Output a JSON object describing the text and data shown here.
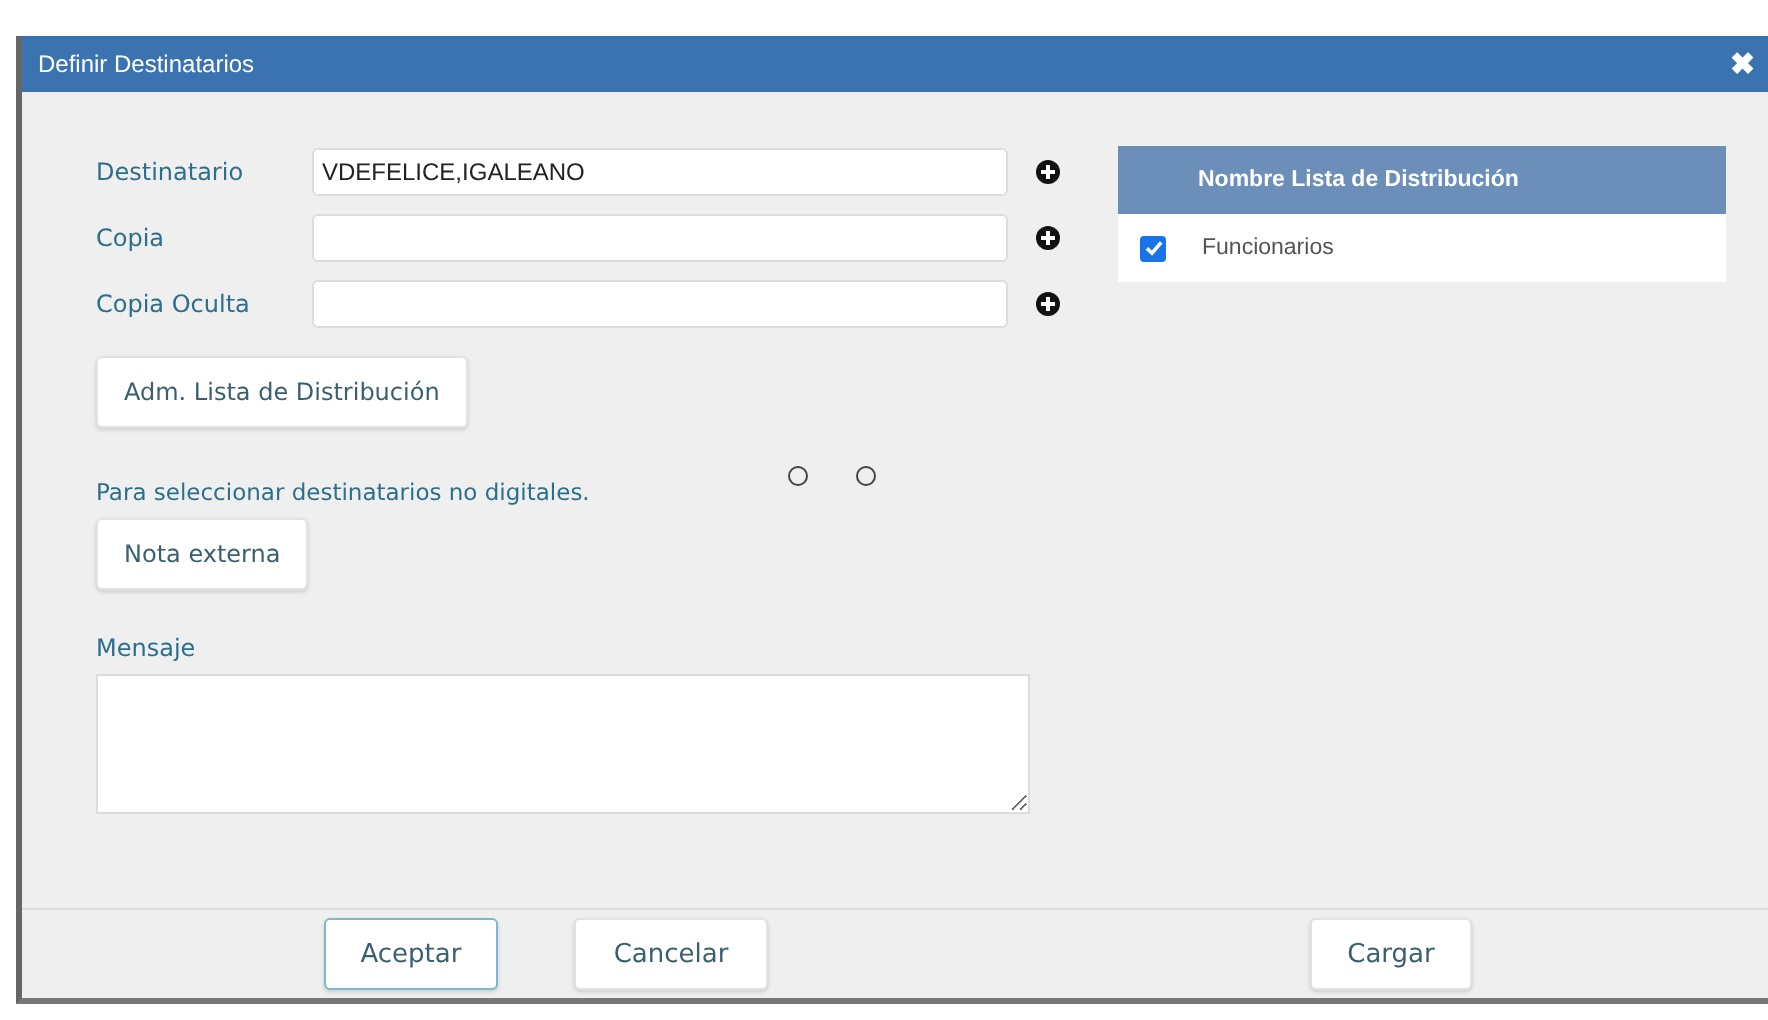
{
  "window": {
    "title": "Definir Destinatarios",
    "close": "✖"
  },
  "fields": [
    {
      "label": "Destinatario",
      "value": "VDEFELICE,IGALEANO"
    },
    {
      "label": "Copia"
    },
    {
      "label": "Copia Oculta"
    }
  ],
  "admin_button": "Adm. Lista de Distribución",
  "note": "Para seleccionar destinatarios no digitales.",
  "external_button": "Nota externa",
  "message": {
    "label": "Mensaje"
  },
  "distribution_table": {
    "columns": [
      "Nombre Lista de Distribución"
    ],
    "rows": [
      {
        "name": "Funcionarios",
        "checked": true
      }
    ]
  },
  "footer_buttons": [
    {
      "label": "Aceptar",
      "focused": true
    },
    {
      "label": "Cancelar",
      "focused": false
    },
    {
      "label": "Cargar",
      "focused": false
    }
  ]
}
